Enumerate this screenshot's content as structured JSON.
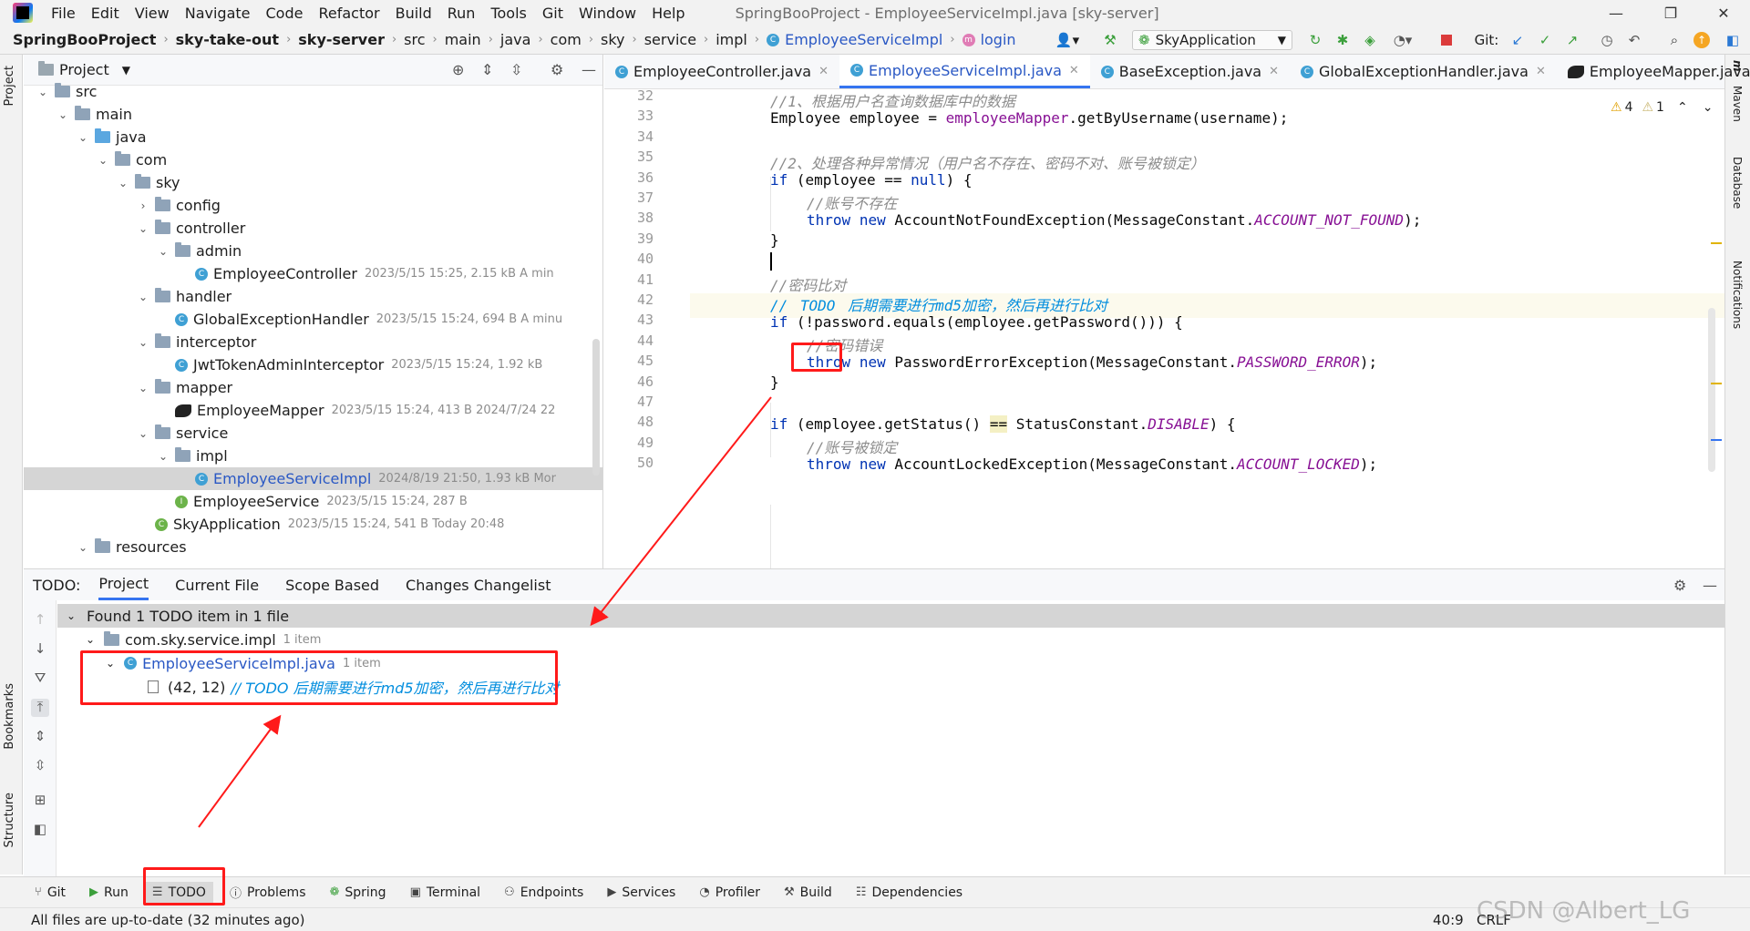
{
  "window": {
    "menu": [
      "File",
      "Edit",
      "View",
      "Navigate",
      "Code",
      "Refactor",
      "Build",
      "Run",
      "Tools",
      "Git",
      "Window",
      "Help"
    ],
    "title": "SpringBooProject - EmployeeServiceImpl.java [sky-server]",
    "controls": {
      "minimize": "—",
      "maximize": "❐",
      "close": "✕"
    }
  },
  "breadcrumb": {
    "items": [
      "SpringBooProject",
      "sky-take-out",
      "sky-server",
      "src",
      "main",
      "java",
      "com",
      "sky",
      "service",
      "impl"
    ],
    "class_name": "EmployeeServiceImpl",
    "method": "login"
  },
  "toolbar": {
    "run_config": "SkyApplication",
    "git_label": "Git:"
  },
  "project_panel": {
    "title": "Project",
    "tree": [
      {
        "label": "src",
        "meta": ""
      },
      {
        "label": "main",
        "meta": ""
      },
      {
        "label": "java",
        "meta": ""
      },
      {
        "label": "com",
        "meta": ""
      },
      {
        "label": "sky",
        "meta": ""
      },
      {
        "label": "config",
        "meta": ""
      },
      {
        "label": "controller",
        "meta": ""
      },
      {
        "label": "admin",
        "meta": ""
      },
      {
        "label": "EmployeeController",
        "meta": "2023/5/15 15:25, 2.15 kB A min"
      },
      {
        "label": "handler",
        "meta": ""
      },
      {
        "label": "GlobalExceptionHandler",
        "meta": "2023/5/15 15:24, 694 B A minu"
      },
      {
        "label": "interceptor",
        "meta": ""
      },
      {
        "label": "JwtTokenAdminInterceptor",
        "meta": "2023/5/15 15:24, 1.92 kB"
      },
      {
        "label": "mapper",
        "meta": ""
      },
      {
        "label": "EmployeeMapper",
        "meta": "2023/5/15 15:24, 413 B 2024/7/24 22"
      },
      {
        "label": "service",
        "meta": ""
      },
      {
        "label": "impl",
        "meta": ""
      },
      {
        "label": "EmployeeServiceImpl",
        "meta": "2024/8/19 21:50, 1.93 kB Mor"
      },
      {
        "label": "EmployeeService",
        "meta": "2023/5/15 15:24, 287 B"
      },
      {
        "label": "SkyApplication",
        "meta": "2023/5/15 15:24, 541 B Today 20:48"
      },
      {
        "label": "resources",
        "meta": ""
      }
    ]
  },
  "editor_tabs": [
    {
      "label": "EmployeeController.java"
    },
    {
      "label": "EmployeeServiceImpl.java"
    },
    {
      "label": "BaseException.java"
    },
    {
      "label": "GlobalExceptionHandler.java"
    },
    {
      "label": "EmployeeMapper.java"
    }
  ],
  "inspections": {
    "warnings": "4",
    "weak_warnings": "1"
  },
  "code": {
    "line_numbers": [
      "32",
      "33",
      "34",
      "35",
      "36",
      "37",
      "38",
      "39",
      "40",
      "41",
      "42",
      "43",
      "44",
      "45",
      "46",
      "47",
      "48",
      "49",
      "50"
    ],
    "l32": "//1、根据用户名查询数据库中的数据",
    "l33_a": "Employee employee = ",
    "l33_b": "employeeMapper",
    "l33_c": ".getByUsername(username);",
    "l35": "//2、处理各种异常情况（用户名不存在、密码不对、账号被锁定）",
    "l36_kw": "if",
    "l36_a": " (employee == ",
    "l36_null": "null",
    "l36_b": ") {",
    "l37": "//账号不存在",
    "l38_kw1": "throw",
    "l38_kw2": "new",
    "l38_a": " AccountNotFoundException(MessageConstant.",
    "l38_c": "ACCOUNT_NOT_FOUND",
    "l38_b": ");",
    "l39": "}",
    "l41": "//密码比对",
    "l42_a": "// ",
    "l42_todo": "TODO",
    "l42_b": " 后期需要进行md5加密，然后再进行比对",
    "l43_kw": "if",
    "l43_a": " (!password.equals(employee.getPassword())) {",
    "l44": "//密码错误",
    "l45_kw1": "throw",
    "l45_kw2": "new",
    "l45_a": " PasswordErrorException(MessageConstant.",
    "l45_c": "PASSWORD_ERROR",
    "l45_b": ");",
    "l46": "}",
    "l48_kw": "if",
    "l48_a": " (employee.getStatus() ",
    "l48_eq": "==",
    "l48_b": " StatusConstant.",
    "l48_c": "DISABLE",
    "l48_d": ") {",
    "l49": "//账号被锁定",
    "l50_kw1": "throw",
    "l50_kw2": "new",
    "l50_a": " AccountLockedException(MessageConstant.",
    "l50_c": "ACCOUNT_LOCKED",
    "l50_b": ");"
  },
  "todo_panel": {
    "label": "TODO:",
    "tabs": [
      "Project",
      "Current File",
      "Scope Based",
      "Changes Changelist"
    ],
    "summary": "Found 1 TODO item in 1 file",
    "package": "com.sky.service.impl",
    "package_count": "1 item",
    "file": "EmployeeServiceImpl.java",
    "file_count": "1 item",
    "item_pos": "(42, 12)",
    "item_text": "// TODO 后期需要进行md5加密，然后再进行比对"
  },
  "bottom_tools": [
    "Git",
    "Run",
    "TODO",
    "Problems",
    "Spring",
    "Terminal",
    "Endpoints",
    "Services",
    "Profiler",
    "Build",
    "Dependencies"
  ],
  "side_tools": {
    "left": [
      "Project",
      "Bookmarks",
      "Structure"
    ],
    "right": [
      "Maven",
      "Database",
      "Notifications"
    ]
  },
  "status": {
    "message": "All files are up-to-date (32 minutes ago)",
    "position": "40:9",
    "line_sep": "CRLF",
    "watermark": "CSDN @Albert_LG"
  },
  "colors": {
    "accent": "#3574f0",
    "annotation": "#ff1a1a",
    "todo": "#008dde"
  }
}
